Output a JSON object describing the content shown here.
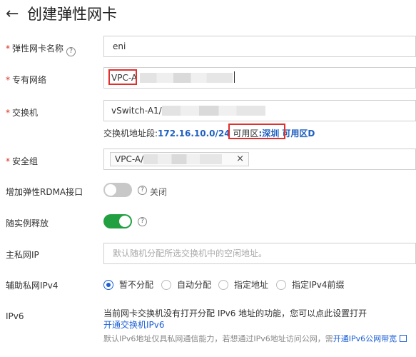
{
  "header": {
    "back_icon": "←",
    "title": "创建弹性网卡"
  },
  "fields": {
    "eni_name": {
      "label": "弹性网卡名称",
      "value": "eni"
    },
    "vpc": {
      "label": "专有网络",
      "value": "VPC-A"
    },
    "vswitch": {
      "label": "交换机",
      "value": "vSwitch-A1/"
    },
    "vswitch_hint": {
      "prefix": "交换机地址段:",
      "cidr": "172.16.10.0/24",
      "mid": " 可用区",
      "zone": ":深圳 可用区D"
    },
    "security_group": {
      "label": "安全组",
      "tag": "VPC-A/",
      "close": "×"
    },
    "rdma": {
      "label": "增加弹性RDMA接口",
      "state": "关闭"
    },
    "release": {
      "label": "随实例释放"
    },
    "primary_ip": {
      "label": "主私网IP",
      "placeholder": "默认随机分配所选交换机中的空闲地址。"
    },
    "secondary_ipv4": {
      "label": "辅助私网IPv4",
      "options": [
        "暂不分配",
        "自动分配",
        "指定地址",
        "指定IPv4前缀"
      ],
      "selected": "暂不分配"
    },
    "ipv6": {
      "label": "IPv6",
      "line1": "当前网卡交换机没有打开分配 IPv6 地址的功能，您可以点此设置打开",
      "link1": "开通交换机IPv6",
      "line3": "默认IPv6地址仅具私网通信能力，若想通过IPv6地址访问公网，需",
      "link3": "开通IPv6公网带宽"
    }
  },
  "icons": {
    "help": "?",
    "external_link": "external-link-icon"
  },
  "colors": {
    "required": "#d93026",
    "link": "#1a5fd6",
    "switch_on": "#22a041",
    "highlight": "#e0302e"
  }
}
